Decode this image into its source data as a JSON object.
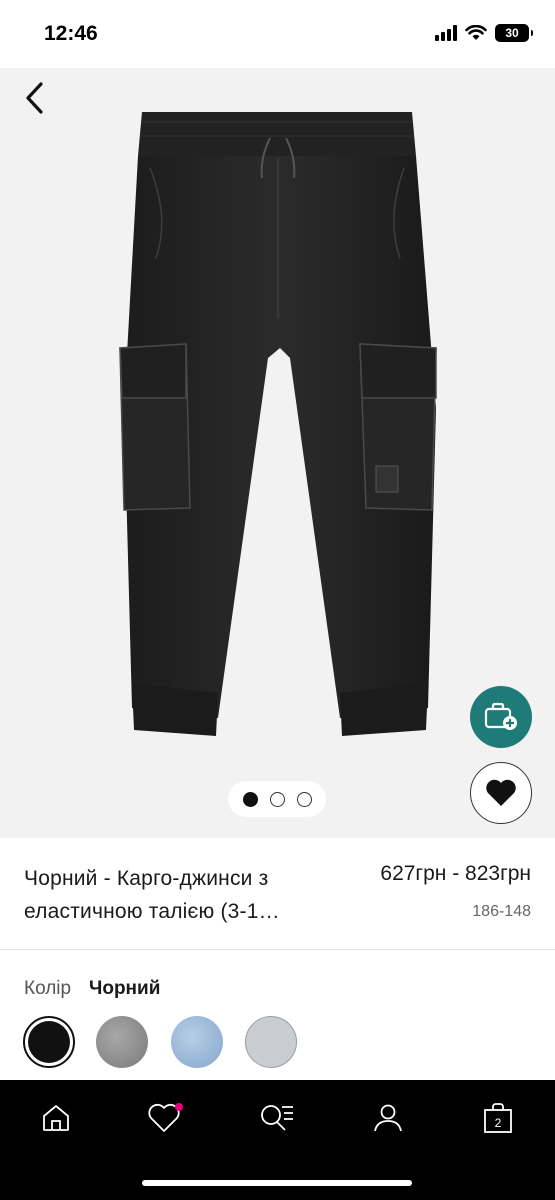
{
  "status_bar": {
    "time": "12:46",
    "battery": "30"
  },
  "product": {
    "title": "Чорний - Карго-джинси з еластичною талією (3-1…",
    "price": "627грн - 823грн",
    "size_range": "186-148",
    "image_count": 3,
    "active_image_index": 0
  },
  "color": {
    "label": "Колір",
    "selected": "Чорний",
    "swatches": [
      {
        "name": "black",
        "color": "#111111"
      },
      {
        "name": "grey-melange",
        "color": "#8f8f8f"
      },
      {
        "name": "light-blue-denim",
        "color": "#9db9d8"
      },
      {
        "name": "light-grey",
        "color": "#c9ccd1"
      }
    ]
  },
  "tab_bar": {
    "bag_count": "2",
    "wishlist_badge_color": "#e6007e"
  },
  "colors": {
    "accent": "#1e7b77",
    "hero_bg": "#f2f2f2"
  }
}
